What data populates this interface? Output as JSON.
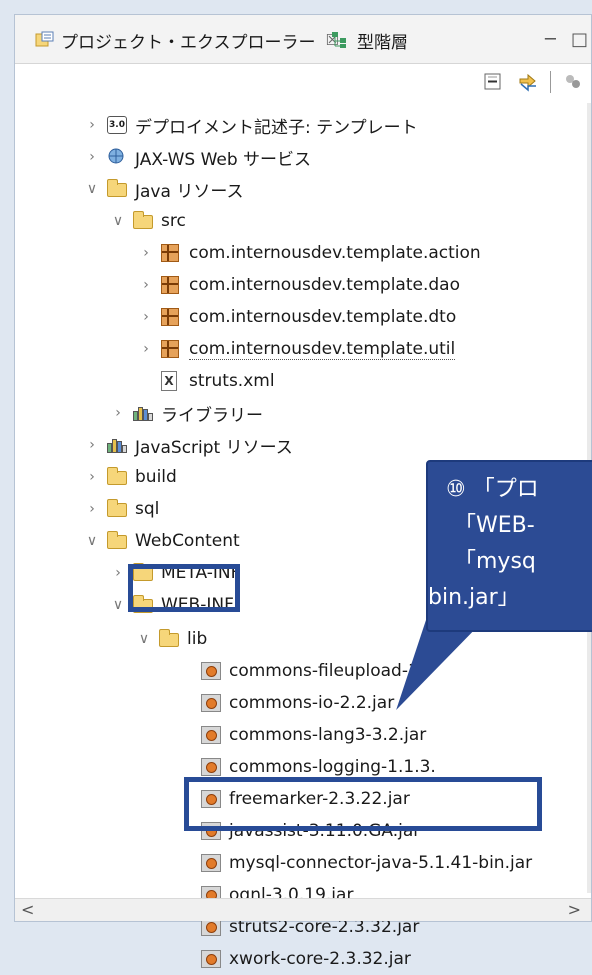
{
  "tabs": {
    "explorer": {
      "label": "プロジェクト・エクスプローラー",
      "close_glyph": "☒"
    },
    "hierarchy": {
      "label": "型階層"
    }
  },
  "window_buttons": {
    "minimize": "─",
    "maximize": "□"
  },
  "toolbar_icons": [
    "collapse-all-icon",
    "link-editor-icon",
    "filter-icon"
  ],
  "tree": [
    {
      "id": "deploy",
      "label": "デプロイメント記述子: テンプレート",
      "expand": "›",
      "icon": "deployment-descriptor-icon"
    },
    {
      "id": "jaxws",
      "label": "JAX-WS Web サービス",
      "expand": "›",
      "icon": "web-service-icon"
    },
    {
      "id": "java",
      "label": "Java リソース",
      "expand": "∨",
      "icon": "java-resources-icon"
    },
    {
      "id": "src",
      "label": "src",
      "expand": "∨",
      "icon": "source-folder-icon"
    },
    {
      "id": "pkg-action",
      "label": "com.internousdev.template.action",
      "expand": "›",
      "icon": "package-icon"
    },
    {
      "id": "pkg-dao",
      "label": "com.internousdev.template.dao",
      "expand": "›",
      "icon": "package-icon"
    },
    {
      "id": "pkg-dto",
      "label": "com.internousdev.template.dto",
      "expand": "›",
      "icon": "package-icon"
    },
    {
      "id": "pkg-util",
      "label": "com.internousdev.template.util",
      "expand": "›",
      "icon": "package-icon"
    },
    {
      "id": "struts-xml",
      "label": "struts.xml",
      "expand": "",
      "icon": "xml-file-icon"
    },
    {
      "id": "library",
      "label": "ライブラリー",
      "expand": "›",
      "icon": "library-icon"
    },
    {
      "id": "js",
      "label": "JavaScript リソース",
      "expand": "›",
      "icon": "library-icon"
    },
    {
      "id": "build",
      "label": "build",
      "expand": "›",
      "icon": "folder-icon"
    },
    {
      "id": "sql",
      "label": "sql",
      "expand": "›",
      "icon": "folder-icon"
    },
    {
      "id": "webcontent",
      "label": "WebContent",
      "expand": "∨",
      "icon": "folder-icon"
    },
    {
      "id": "meta-inf",
      "label": "META-INF",
      "expand": "›",
      "icon": "folder-icon"
    },
    {
      "id": "web-inf",
      "label": "WEB-INF",
      "expand": "∨",
      "icon": "folder-icon"
    },
    {
      "id": "lib",
      "label": "lib",
      "expand": "∨",
      "icon": "folder-icon"
    },
    {
      "id": "jar-fileupload",
      "label": "commons-fileupload-1",
      "expand": "",
      "icon": "jar-icon"
    },
    {
      "id": "jar-io",
      "label": "commons-io-2.2.jar",
      "expand": "",
      "icon": "jar-icon"
    },
    {
      "id": "jar-lang3",
      "label": "commons-lang3-3.2.jar",
      "expand": "",
      "icon": "jar-icon"
    },
    {
      "id": "jar-logging",
      "label": "commons-logging-1.1.3.",
      "expand": "",
      "icon": "jar-icon"
    },
    {
      "id": "jar-freemarker",
      "label": "freemarker-2.3.22.jar",
      "expand": "",
      "icon": "jar-icon"
    },
    {
      "id": "jar-javassist",
      "label": "javassist-3.11.0.GA.jar",
      "expand": "",
      "icon": "jar-icon"
    },
    {
      "id": "jar-mysql",
      "label": "mysql-connector-java-5.1.41-bin.jar",
      "expand": "",
      "icon": "jar-icon"
    },
    {
      "id": "jar-ognl",
      "label": "ognl-3.0.19.jar",
      "expand": "",
      "icon": "jar-icon"
    },
    {
      "id": "jar-struts2",
      "label": "struts2-core-2.3.32.jar",
      "expand": "",
      "icon": "jar-icon"
    },
    {
      "id": "jar-xwork",
      "label": "xwork-core-2.3.32.jar",
      "expand": "",
      "icon": "jar-icon"
    }
  ],
  "callout": {
    "line1": "⑩ 「プロ",
    "line2": "「WEB-",
    "line3": "「mysq",
    "line4": "bin.jar」"
  },
  "scrollbar": {
    "left": "<",
    "right": ">"
  },
  "colors": {
    "highlight": "#284b96",
    "callout": "#2c4b94"
  }
}
